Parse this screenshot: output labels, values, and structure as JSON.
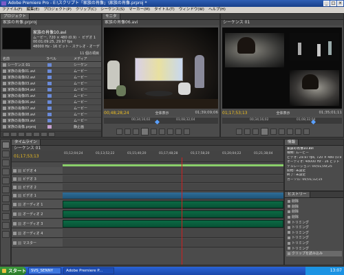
{
  "window": {
    "title": "Adobe Premiere Pro - E:\\スクリプト「家族の肖像」\\家族の肖像.prproj *"
  },
  "menubar": [
    "ファイル(F)",
    "編集(E)",
    "プロジェクト(P)",
    "クリップ(C)",
    "シーケンス(S)",
    "マーカー(M)",
    "タイトル(T)",
    "ウィンドウ(W)",
    "ヘルプ(H)"
  ],
  "project": {
    "tab": "プロジェクト",
    "subtab": "家族の肖像.prproj",
    "clip_name": "家族の肖像10.avi",
    "clip_info": [
      "ムービー, 720 × 480 (0.9) ・ ビデオ 1",
      "00:01:09:25, 29.97 fps",
      "48000 Hz - 16 ビット - ステレオ - オーデ"
    ],
    "count": "11 個の項目",
    "col_name": "名前",
    "col_label": "ラベル",
    "col_media": "メディア",
    "items": [
      {
        "name": "シーケンス 01",
        "media": "シーケン"
      },
      {
        "name": "家族の肖像01.avi",
        "media": "ムービー"
      },
      {
        "name": "家族の肖像02.avi",
        "media": "ムービー"
      },
      {
        "name": "家族の肖像03.avi",
        "media": "ムービー"
      },
      {
        "name": "家族の肖像04.avi",
        "media": "ムービー"
      },
      {
        "name": "家族の肖像05.avi",
        "media": "ムービー"
      },
      {
        "name": "家族の肖像06.avi",
        "media": "ムービー"
      },
      {
        "name": "家族の肖像07.avi",
        "media": "ムービー"
      },
      {
        "name": "家族の肖像08.avi",
        "media": "ムービー"
      },
      {
        "name": "家族の肖像09.avi",
        "media": "ムービー"
      },
      {
        "name": "家族の肖像.prproj",
        "media": "静止画"
      }
    ]
  },
  "source_monitor": {
    "tab": "モニタ",
    "subtab": "家族の肖像06.avi",
    "timecode_left": "00;48;28;24",
    "fit": "全体表示",
    "timecode_right": "01;39;09;06",
    "ruler": [
      "00;34;16;02",
      "01;08;32;04"
    ]
  },
  "program_monitor": {
    "subtab": "シーケンス 01",
    "timecode_left": "01;17;53;13",
    "fit": "全体表示",
    "timecode_right": "01;35;01;11",
    "ruler": [
      "00;34;16;02",
      "01;08;32;04"
    ]
  },
  "timeline": {
    "tab": "タイムライン",
    "sequence_tab": "シーケンス 01",
    "timecode": "01;17;53;13",
    "ruler": [
      "01;12;04;24",
      "01;13;52;22",
      "01;15;40;20",
      "01;17;48;28",
      "01;17;58;20",
      "01;20;04;22",
      "01;21;38;04"
    ],
    "tracks": [
      "ビデオ 4",
      "ビデオ 3",
      "ビデオ 2",
      "ビデオ 1",
      "オーディオ 1",
      "オーディオ 2",
      "オーディオ 3",
      "オーディオ 4",
      "マスター"
    ]
  },
  "info": {
    "tab": "情報",
    "name": "家族の肖像10.avi",
    "type": "種類: ムービー",
    "lines": [
      "ビデオ: 29.97 fps, 720 × 480 (0.9)",
      "オーディオ: 48000 Hz - 16 ビット",
      "デュレーション: 00;01;09;25",
      "開始: 未設定",
      "終了: 未設定",
      "カーソル: 00;01;12;15"
    ]
  },
  "history": {
    "tab": "ヒストリー",
    "items": [
      "削除",
      "削除",
      "削除",
      "削除",
      "トリミング",
      "トリミング",
      "トリミング",
      "トリミング",
      "トリミング",
      "トリミング",
      "クリップを読み込み"
    ]
  },
  "taskbar": {
    "start": "スタート",
    "tasks": [
      "SVS_SENNY",
      "Adobe Premiere P..."
    ],
    "time": "13:07"
  },
  "colors": {
    "accent_timecode": "#f0c020",
    "clip_video": "#2f6d98",
    "clip_audio": "#0b6a44",
    "playhead": "#d02020"
  }
}
